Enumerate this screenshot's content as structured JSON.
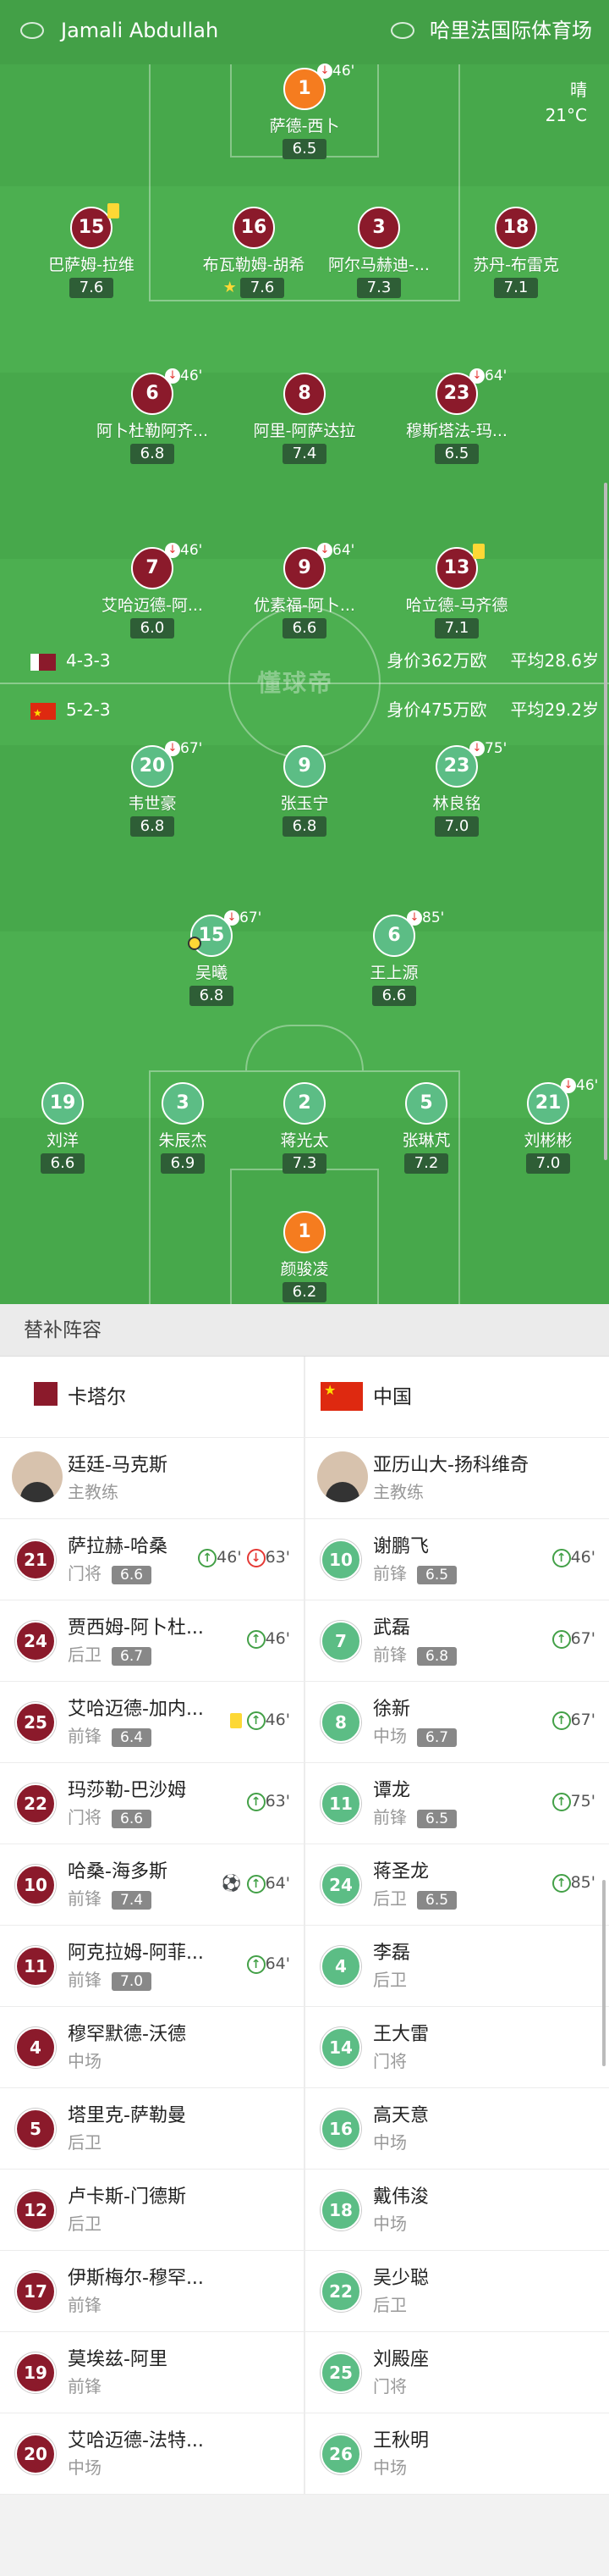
{
  "header": {
    "home_team": "Jamali Abdullah",
    "venue": "哈里法国际体育场",
    "weather": "晴",
    "temp": "21°C"
  },
  "watermark": "懂球帝",
  "teams": {
    "qatar": {
      "name": "卡塔尔",
      "formation": "4-3-3",
      "value": "身价362万欧",
      "age": "平均28.6岁",
      "color": "#8b1a2b"
    },
    "china": {
      "name": "中国",
      "formation": "5-2-3",
      "value": "身价475万欧",
      "age": "平均29.2岁",
      "color": "#5cbd85"
    }
  },
  "pitch_qatar": [
    {
      "num": "1",
      "name": "萨德-西卜",
      "rating": "6.5",
      "sub": "46'"
    },
    {
      "num": "15",
      "name": "巴萨姆-拉维",
      "rating": "7.6",
      "card": "yellow"
    },
    {
      "num": "16",
      "name": "布瓦勒姆-胡希",
      "rating": "7.6",
      "star": "★"
    },
    {
      "num": "3",
      "name": "阿尔马赫迪-...",
      "rating": "7.3"
    },
    {
      "num": "18",
      "name": "苏丹-布雷克",
      "rating": "7.1"
    },
    {
      "num": "6",
      "name": "阿卜杜勒阿齐...",
      "rating": "6.8",
      "sub": "46'"
    },
    {
      "num": "8",
      "name": "阿里-阿萨达拉",
      "rating": "7.4"
    },
    {
      "num": "23",
      "name": "穆斯塔法-玛...",
      "rating": "6.5",
      "sub": "64'"
    },
    {
      "num": "7",
      "name": "艾哈迈德-阿...",
      "rating": "6.0",
      "sub": "46'"
    },
    {
      "num": "9",
      "name": "优素福-阿卜...",
      "rating": "6.6",
      "sub": "64'"
    },
    {
      "num": "13",
      "name": "哈立德-马齐德",
      "rating": "7.1",
      "card": "yellow"
    }
  ],
  "pitch_china": [
    {
      "num": "20",
      "name": "韦世豪",
      "rating": "6.8",
      "sub": "67'"
    },
    {
      "num": "9",
      "name": "张玉宁",
      "rating": "6.8"
    },
    {
      "num": "23",
      "name": "林良铭",
      "rating": "7.0",
      "sub": "75'"
    },
    {
      "num": "15",
      "name": "吴曦",
      "rating": "6.8",
      "sub": "67'"
    },
    {
      "num": "6",
      "name": "王上源",
      "rating": "6.6",
      "sub": "85'"
    },
    {
      "num": "19",
      "name": "刘洋",
      "rating": "6.6"
    },
    {
      "num": "3",
      "name": "朱辰杰",
      "rating": "6.9"
    },
    {
      "num": "2",
      "name": "蒋光太",
      "rating": "7.3"
    },
    {
      "num": "5",
      "name": "张琳芃",
      "rating": "7.2"
    },
    {
      "num": "21",
      "name": "刘彬彬",
      "rating": "7.0",
      "sub": "46'"
    },
    {
      "num": "1",
      "name": "颜骏凌",
      "rating": "6.2"
    }
  ],
  "subs_section": {
    "title": "替补阵容"
  },
  "coaches": {
    "qatar": {
      "name": "廷廷-马克斯",
      "role": "主教练"
    },
    "china": {
      "name": "亚历山大-扬科维奇",
      "role": "主教练"
    }
  },
  "subs_qatar": [
    {
      "num": "21",
      "name": "萨拉赫-哈桑",
      "pos": "门将",
      "rating": "6.6",
      "up": "46'",
      "down": "63'"
    },
    {
      "num": "24",
      "name": "贾西姆-阿卜杜...",
      "pos": "后卫",
      "rating": "6.7",
      "up": "46'"
    },
    {
      "num": "25",
      "name": "艾哈迈德-加内...",
      "pos": "前锋",
      "rating": "6.4",
      "up": "46'",
      "card": "yellow"
    },
    {
      "num": "22",
      "name": "玛莎勒-巴沙姆",
      "pos": "门将",
      "rating": "6.6",
      "up": "63'"
    },
    {
      "num": "10",
      "name": "哈桑-海多斯",
      "pos": "前锋",
      "rating": "7.4",
      "up": "64'",
      "goal": "⚽"
    },
    {
      "num": "11",
      "name": "阿克拉姆-阿菲...",
      "pos": "前锋",
      "rating": "7.0",
      "up": "64'"
    },
    {
      "num": "4",
      "name": "穆罕默德-沃德",
      "pos": "中场"
    },
    {
      "num": "5",
      "name": "塔里克-萨勒曼",
      "pos": "后卫"
    },
    {
      "num": "12",
      "name": "卢卡斯-门德斯",
      "pos": "后卫"
    },
    {
      "num": "17",
      "name": "伊斯梅尔-穆罕...",
      "pos": "前锋"
    },
    {
      "num": "19",
      "name": "莫埃兹-阿里",
      "pos": "前锋"
    },
    {
      "num": "20",
      "name": "艾哈迈德-法特...",
      "pos": "中场"
    }
  ],
  "subs_china": [
    {
      "num": "10",
      "name": "谢鹏飞",
      "pos": "前锋",
      "rating": "6.5",
      "up": "46'"
    },
    {
      "num": "7",
      "name": "武磊",
      "pos": "前锋",
      "rating": "6.8",
      "up": "67'"
    },
    {
      "num": "8",
      "name": "徐新",
      "pos": "中场",
      "rating": "6.7",
      "up": "67'"
    },
    {
      "num": "11",
      "name": "谭龙",
      "pos": "前锋",
      "rating": "6.5",
      "up": "75'"
    },
    {
      "num": "24",
      "name": "蒋圣龙",
      "pos": "后卫",
      "rating": "6.5",
      "up": "85'"
    },
    {
      "num": "4",
      "name": "李磊",
      "pos": "后卫"
    },
    {
      "num": "14",
      "name": "王大雷",
      "pos": "门将"
    },
    {
      "num": "16",
      "name": "高天意",
      "pos": "中场"
    },
    {
      "num": "18",
      "name": "戴伟浚",
      "pos": "中场"
    },
    {
      "num": "22",
      "name": "吴少聪",
      "pos": "后卫"
    },
    {
      "num": "25",
      "name": "刘殿座",
      "pos": "门将"
    },
    {
      "num": "26",
      "name": "王秋明",
      "pos": "中场"
    }
  ]
}
